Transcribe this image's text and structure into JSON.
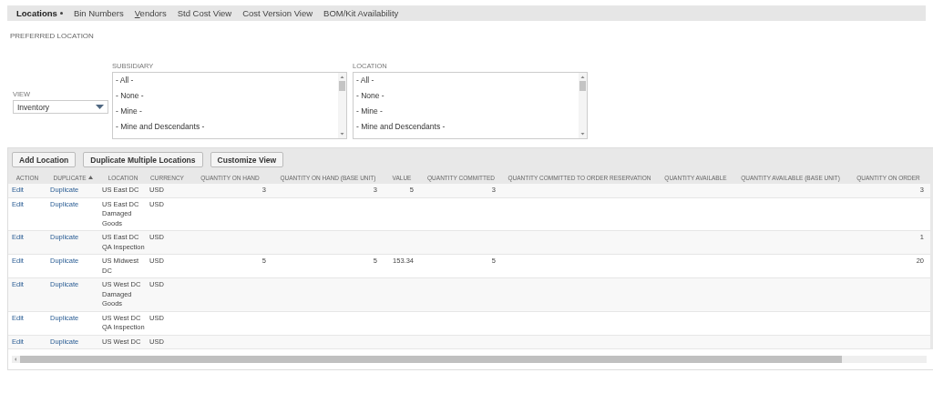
{
  "tabs": [
    {
      "label": "Locations",
      "selected": true,
      "underlined_initial": false
    },
    {
      "label": "Bin Numbers",
      "selected": false,
      "underlined_initial": false
    },
    {
      "label": "Vendors",
      "selected": false,
      "underlined_initial": true
    },
    {
      "label": "Std Cost View",
      "selected": false,
      "underlined_initial": false
    },
    {
      "label": "Cost Version View",
      "selected": false,
      "underlined_initial": false
    },
    {
      "label": "BOM/Kit Availability",
      "selected": false,
      "underlined_initial": false
    }
  ],
  "section_label": "PREFERRED LOCATION",
  "view": {
    "label": "VIEW",
    "value": "Inventory"
  },
  "filters": [
    {
      "label": "SUBSIDIARY",
      "options": [
        "- All -",
        "- None -",
        "- Mine -",
        "- Mine and Descendants -"
      ]
    },
    {
      "label": "LOCATION",
      "options": [
        "- All -",
        "- None -",
        "- Mine -",
        "- Mine and Descendants -"
      ]
    }
  ],
  "buttons": [
    "Add Location",
    "Duplicate Multiple Locations",
    "Customize View"
  ],
  "table": {
    "columns": [
      {
        "label": "ACTION",
        "kind": "link",
        "sorted_ascending": false
      },
      {
        "label": "DUPLICATE",
        "kind": "link",
        "sorted_ascending": true
      },
      {
        "label": "LOCATION",
        "kind": "text",
        "sorted_ascending": false
      },
      {
        "label": "CURRENCY",
        "kind": "text",
        "sorted_ascending": false
      },
      {
        "label": "QUANTITY ON HAND",
        "kind": "number",
        "sorted_ascending": false
      },
      {
        "label": "QUANTITY ON HAND (BASE UNIT)",
        "kind": "number",
        "sorted_ascending": false
      },
      {
        "label": "VALUE",
        "kind": "number",
        "sorted_ascending": false
      },
      {
        "label": "QUANTITY COMMITTED",
        "kind": "number",
        "sorted_ascending": false
      },
      {
        "label": "QUANTITY COMMITTED TO ORDER RESERVATION",
        "kind": "number",
        "sorted_ascending": false
      },
      {
        "label": "QUANTITY AVAILABLE",
        "kind": "number",
        "sorted_ascending": false
      },
      {
        "label": "QUANTITY AVAILABLE (BASE UNIT)",
        "kind": "number",
        "sorted_ascending": false
      },
      {
        "label": "QUANTITY ON ORDER",
        "kind": "number",
        "sorted_ascending": false
      }
    ],
    "rows": [
      [
        "Edit",
        "Duplicate",
        "US East DC",
        "USD",
        "3",
        "3",
        "5",
        "3",
        null,
        null,
        null,
        "3"
      ],
      [
        "Edit",
        "Duplicate",
        "US East DC Damaged Goods",
        "USD",
        null,
        null,
        null,
        null,
        null,
        null,
        null,
        null
      ],
      [
        "Edit",
        "Duplicate",
        "US East DC QA Inspection",
        "USD",
        null,
        null,
        null,
        null,
        null,
        null,
        null,
        "1"
      ],
      [
        "Edit",
        "Duplicate",
        "US Midwest DC",
        "USD",
        "5",
        "5",
        "153.34",
        "5",
        null,
        null,
        null,
        "20"
      ],
      [
        "Edit",
        "Duplicate",
        "US West DC Damaged Goods",
        "USD",
        null,
        null,
        null,
        null,
        null,
        null,
        null,
        null
      ],
      [
        "Edit",
        "Duplicate",
        "US West DC QA Inspection",
        "USD",
        null,
        null,
        null,
        null,
        null,
        null,
        null,
        null
      ],
      [
        "Edit",
        "Duplicate",
        "US West DC",
        "USD",
        null,
        null,
        null,
        null,
        null,
        null,
        null,
        null
      ]
    ]
  }
}
